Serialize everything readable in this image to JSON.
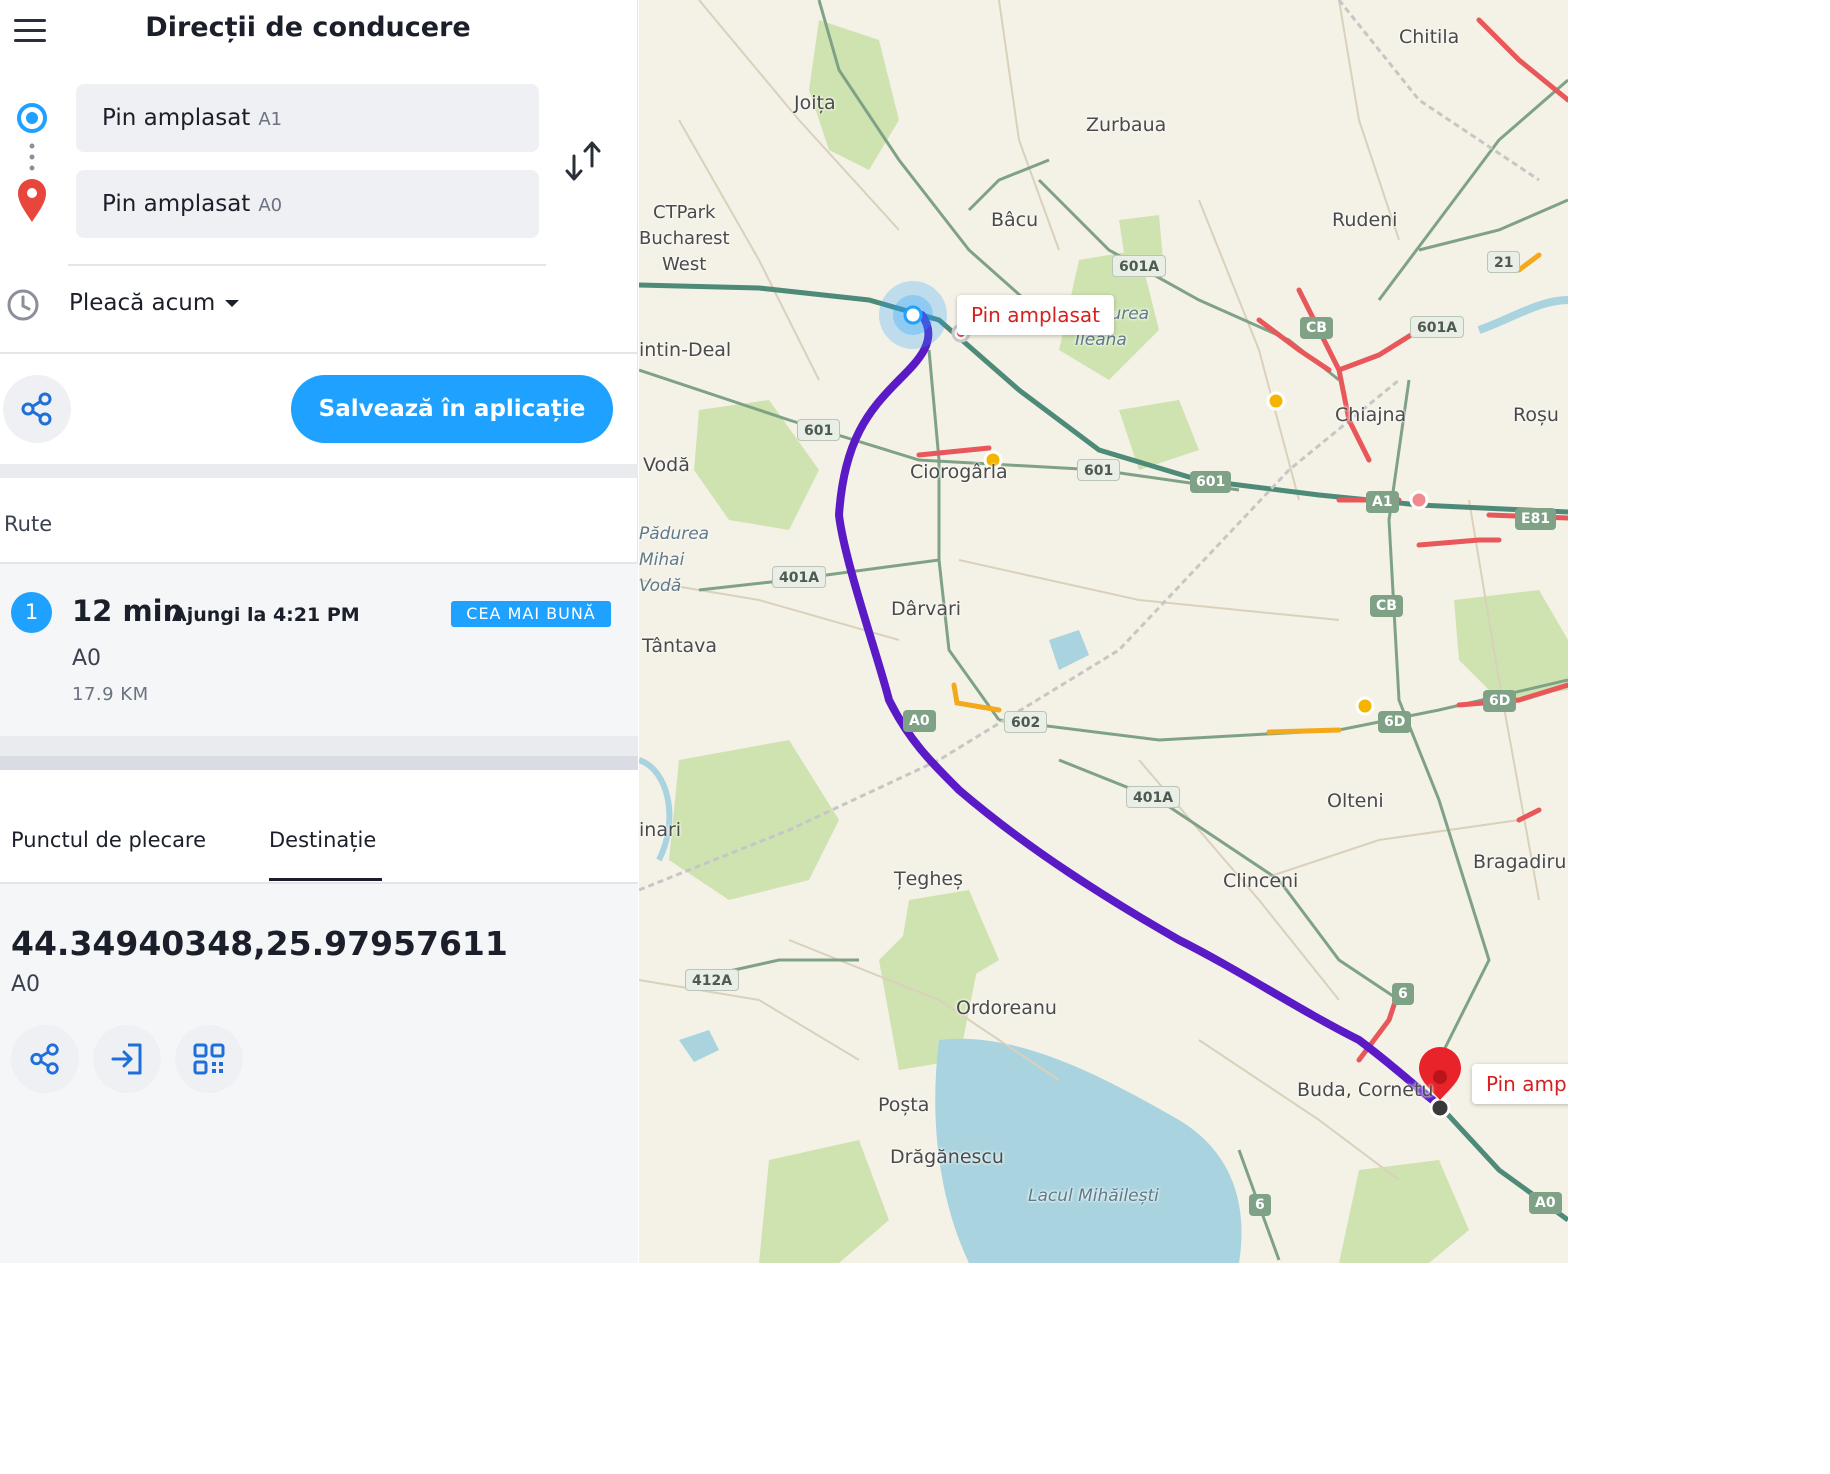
{
  "header": {
    "title": "Direcții de conducere",
    "menu_icon": "hamburger-menu-icon"
  },
  "route_inputs": {
    "origin": {
      "label": "Pin amplasat",
      "sub": "A1",
      "icon": "origin-circle-icon",
      "color": "#1ea1ff"
    },
    "destination": {
      "label": "Pin amplasat",
      "sub": "A0",
      "icon": "destination-pin-icon",
      "color": "#e8453c"
    },
    "swap_icon": "swap-arrows-icon"
  },
  "departure": {
    "label": "Pleacă acum",
    "icon": "clock-icon"
  },
  "actions": {
    "share_icon": "share-icon",
    "save_label": "Salvează în aplicație",
    "accent": "#1ea1ff"
  },
  "routes": {
    "section_label": "Rute",
    "items": [
      {
        "index": "1",
        "duration": "12 min",
        "arrival": "Ajungi la 4:21 PM",
        "badge": "CEA MAI BUNĂ",
        "road": "A0",
        "distance": "17.9 KM"
      }
    ]
  },
  "tabs": [
    {
      "label": "Punctul de plecare",
      "selected": false
    },
    {
      "label": "Destinație",
      "selected": true
    }
  ],
  "destination_details": {
    "coordinates": "44.34940348,25.97957611",
    "road": "A0",
    "action_icons": [
      "share-icon",
      "navigate-to-app-icon",
      "qr-code-icon"
    ]
  },
  "map": {
    "route_color": "#5a1bc6",
    "traffic_colors": {
      "heavy": "#e8585a",
      "moderate": "#f3a91b"
    },
    "places": [
      "Chitila",
      "Joița",
      "Zurbaua",
      "Bâcu",
      "Rudeni",
      "CTPark",
      "Bucharest",
      "West",
      "Pădurea",
      "Ileana",
      "intin-Deal",
      "Chiajna",
      "Roșu",
      "Vodă",
      "Ciorogârla",
      "Pădurea",
      "Mihai",
      "Vodă",
      "Dârvari",
      "Tântava",
      "Olteni",
      "inari",
      "Țegheș",
      "Clinceni",
      "Bragadiru",
      "Ordoreanu",
      "Poșta",
      "Buda, Cornetu",
      "Drăgănescu",
      "Lacul Mihăilești"
    ],
    "road_shields": [
      "601A",
      "601",
      "601",
      "601",
      "401A",
      "A0",
      "602",
      "401A",
      "6D",
      "6D",
      "CB",
      "CB",
      "A1",
      "E81",
      "601A",
      "21",
      "412A",
      "6",
      "6",
      "A0"
    ],
    "pins": [
      {
        "label": "Pin amplasat",
        "type": "origin"
      },
      {
        "label": "Pin amplasat",
        "type": "destination"
      }
    ]
  }
}
